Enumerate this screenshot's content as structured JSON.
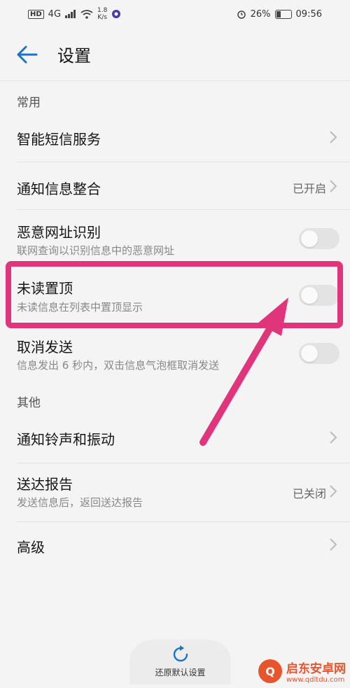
{
  "status_bar": {
    "network": "4G",
    "speed_value": "1.8",
    "speed_unit": "K/s",
    "battery": "26%",
    "time": "09:56"
  },
  "header": {
    "title": "设置"
  },
  "sections": [
    {
      "label": "常用",
      "items": [
        {
          "title": "智能短信服务",
          "type": "chevron"
        },
        {
          "title": "通知信息整合",
          "value": "已开启",
          "type": "chevron"
        },
        {
          "title": "恶意网址识别",
          "subtitle": "联网查询以识别信息中的恶意网址",
          "type": "toggle",
          "on": false
        },
        {
          "title": "未读置顶",
          "subtitle": "未读信息在列表中置顶显示",
          "type": "toggle",
          "on": false
        },
        {
          "title": "取消发送",
          "subtitle": "信息发出 6 秒内，双击信息气泡框取消发送",
          "type": "toggle",
          "on": false
        }
      ]
    },
    {
      "label": "其他",
      "items": [
        {
          "title": "通知铃声和振动",
          "type": "chevron"
        },
        {
          "title": "送达报告",
          "subtitle": "发送信息后，返回送达报告",
          "value": "已关闭",
          "type": "chevron"
        },
        {
          "title": "高级",
          "type": "chevron"
        }
      ]
    }
  ],
  "reset": {
    "label": "还原默认设置"
  },
  "watermark": {
    "title": "启东安卓网",
    "url": "www.qdltdu.com"
  },
  "colors": {
    "highlight": "#e0357b",
    "accent": "#1a73c8",
    "watermark": "#e8542b"
  }
}
